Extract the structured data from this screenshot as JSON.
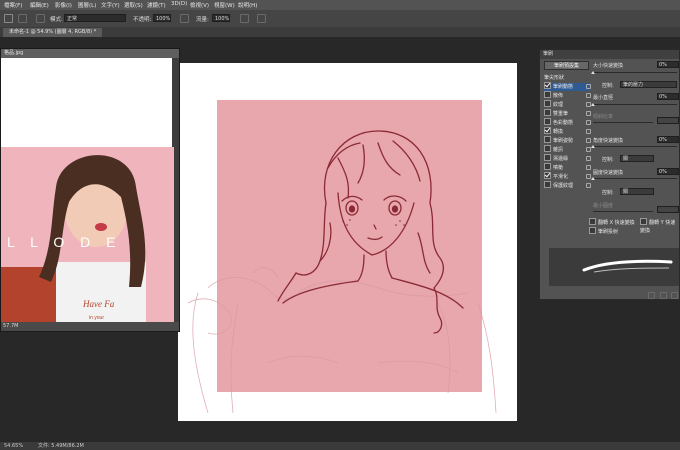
{
  "menubar": {
    "items": [
      "檔案(F)",
      "編輯(E)",
      "影像(I)",
      "圖層(L)",
      "文字(Y)",
      "選取(S)",
      "濾鏡(T)",
      "3D(D)",
      "檢視(V)",
      "視窗(W)",
      "說明(H)"
    ]
  },
  "options": {
    "mode_label": "模式:",
    "mode_value": "正常",
    "opacity_label": "不透明:",
    "opacity_value": "100%",
    "flow_label": "流量:",
    "flow_value": "100%"
  },
  "document_tab": {
    "label": "未命名-1 @ 54.9% (圖層 4, RGB/8) *"
  },
  "reference_window": {
    "title": "格品.jpg",
    "photo_text": "L L O   D E",
    "shirt_text": "Have Fa",
    "shirt_sub": "in your",
    "status": "57.7M"
  },
  "brush_panel": {
    "tab": "筆刷",
    "preset_button": "筆刷預設集",
    "tip_shape": "筆尖形狀",
    "items": [
      {
        "label": "筆刷動態",
        "checked": true,
        "selected": true
      },
      {
        "label": "散佈",
        "checked": false,
        "selected": false
      },
      {
        "label": "紋理",
        "checked": false,
        "selected": false
      },
      {
        "label": "雙重筆",
        "checked": false,
        "selected": false
      },
      {
        "label": "色彩動態",
        "checked": false,
        "selected": false
      },
      {
        "label": "轉換",
        "checked": true,
        "selected": false
      },
      {
        "label": "筆刷姿勢",
        "checked": false,
        "selected": false
      },
      {
        "label": "雜訊",
        "checked": false,
        "selected": false
      },
      {
        "label": "濕邊緣",
        "checked": false,
        "selected": false
      },
      {
        "label": "噴槍",
        "checked": false,
        "selected": false
      },
      {
        "label": "平滑化",
        "checked": true,
        "selected": false
      },
      {
        "label": "保護紋理",
        "checked": false,
        "selected": false
      }
    ],
    "size_jitter": {
      "label": "大小快速變換",
      "value": "0%"
    },
    "control1": {
      "label": "控制:",
      "value": "筆的壓力"
    },
    "min_diameter": {
      "label": "最小直徑",
      "value": "0%"
    },
    "tilt_scale": {
      "label": "傾斜比率"
    },
    "angle_jitter": {
      "label": "角度快速變換",
      "value": "0%"
    },
    "control2": {
      "label": "控制:",
      "value": "關"
    },
    "roundness_jitter": {
      "label": "圓度快速變換",
      "value": "0%"
    },
    "control3": {
      "label": "控制:",
      "value": "關"
    },
    "min_roundness": {
      "label": "最小圓度"
    },
    "flip_x": "翻轉 X 快速變換",
    "flip_y": "翻轉 Y 快速變換",
    "brush_projection": "筆刷投射"
  },
  "statusbar": {
    "zoom": "54.65%",
    "doc": "文件: 5.49M/86.2M"
  },
  "colors": {
    "canvas_pink": "#e8a6ad",
    "line_art": "#8b2a36",
    "panel_bg": "#535353"
  }
}
